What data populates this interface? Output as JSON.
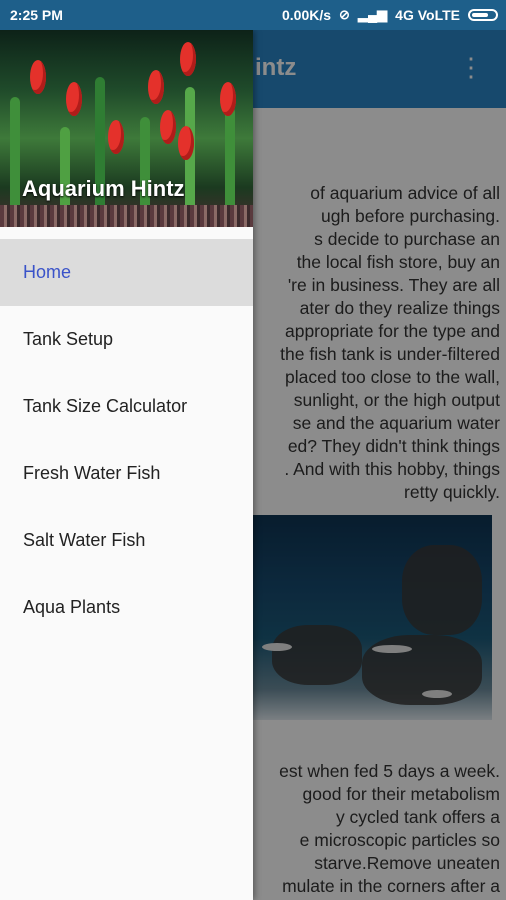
{
  "status_bar": {
    "time": "2:25 PM",
    "speed": "0.00K/s",
    "network": "4G VoLTE"
  },
  "app_bar": {
    "title": "intz"
  },
  "content": {
    "paragraph1": "of aquarium advice of all\nugh before purchasing.\ns decide to purchase an\nthe local fish store, buy an\n're in business. They are all\nater do they realize things\nappropriate for the type and\nthe fish tank is under-filtered\nplaced too close to the wall,\nsunlight, or the high output\nse and the aquarium water\ned? They didn't think things\n. And with this hobby, things\nretty quickly.",
    "paragraph2": "est when fed 5 days a week.\ngood for their metabolism\ny cycled tank offers a\ne microscopic particles so\nstarve.Remove uneaten\nmulate in the corners after a"
  },
  "drawer": {
    "title": "Aquarium Hintz",
    "items": [
      {
        "label": "Home"
      },
      {
        "label": "Tank Setup"
      },
      {
        "label": "Tank Size Calculator"
      },
      {
        "label": "Fresh Water Fish"
      },
      {
        "label": "Salt Water Fish"
      },
      {
        "label": "Aqua Plants"
      }
    ],
    "active_index": 0
  },
  "colors": {
    "status_bar": "#1e5f8a",
    "app_bar": "#2a86c7",
    "active_item_text": "#3a53c9",
    "active_item_bg": "#dcdcdc"
  },
  "icons": {
    "overflow": "more-vert-icon",
    "battery": "battery-icon",
    "signal": "signal-icon",
    "alarm": "alarm-icon"
  }
}
